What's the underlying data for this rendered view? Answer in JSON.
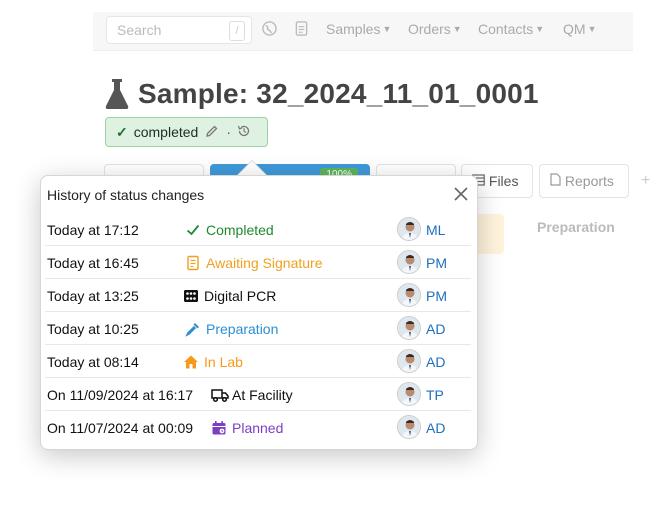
{
  "navbar": {
    "search_placeholder": "Search",
    "search_key": "/",
    "menus": [
      "Samples",
      "Orders",
      "Contacts",
      "QM"
    ]
  },
  "sample": {
    "title": "Sample: 32_2024_11_01_0001",
    "status_label": "completed"
  },
  "tabs": {
    "progress_badge": "100%",
    "files": "Files",
    "reports": "Reports",
    "preparation": "Preparation"
  },
  "popover": {
    "title": "History of status changes",
    "rows": [
      {
        "time": "Today at 17:12",
        "status": "Completed",
        "icon": "check-icon",
        "color": "#1e8a2e",
        "initials": "ML"
      },
      {
        "time": "Today at 16:45",
        "status": "Awaiting Signature",
        "icon": "document-icon",
        "color": "#f0a020",
        "initials": "PM"
      },
      {
        "time": "Today at 13:25",
        "status": "Digital PCR",
        "icon": "pcr-plate-icon",
        "color": "#111111",
        "initials": "PM"
      },
      {
        "time": "Today at 10:25",
        "status": "Preparation",
        "icon": "pipette-icon",
        "color": "#2a8fd4",
        "initials": "AD"
      },
      {
        "time": "Today at 08:14",
        "status": "In Lab",
        "icon": "house-icon",
        "color": "#f59a1b",
        "initials": "AD"
      },
      {
        "time": "On 11/09/2024 at 16:17",
        "status": "At Facility",
        "icon": "truck-icon",
        "color": "#111111",
        "initials": "TP"
      },
      {
        "time": "On 11/07/2024 at 00:09",
        "status": "Planned",
        "icon": "calendar-icon",
        "color": "#7b3fc4",
        "initials": "AD"
      }
    ]
  }
}
